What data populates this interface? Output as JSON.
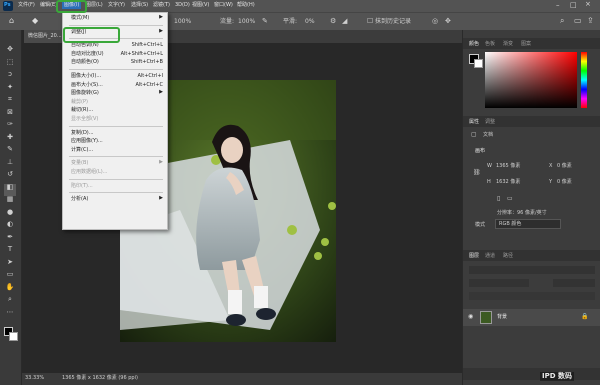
{
  "app": {
    "logo": "Ps"
  },
  "menubar": {
    "items": [
      "文件(F)",
      "编辑(E)",
      "图像(I)",
      "图层(L)",
      "文字(Y)",
      "选择(S)",
      "滤镜(T)",
      "3D(D)",
      "视图(V)",
      "窗口(W)",
      "帮助(H)"
    ],
    "active_index": 2
  },
  "options_bar": {
    "zoom_a": "100%",
    "opacity_label": "流量:",
    "zoom_b": "100%",
    "smooth_label": "平滑:",
    "zoom_c": "0%",
    "history_label": "抹到历史记录"
  },
  "document": {
    "tab_title": "微信图片_20..."
  },
  "image_menu": {
    "items": [
      {
        "label": "模式(M)",
        "submenu": true
      },
      {
        "sep": true
      },
      {
        "label": "调整(J)",
        "submenu": true
      },
      {
        "sep": true
      },
      {
        "label": "自动色调(N)",
        "shortcut": "Shift+Ctrl+L"
      },
      {
        "label": "自动对比度(U)",
        "shortcut": "Alt+Shift+Ctrl+L"
      },
      {
        "label": "自动颜色(O)",
        "shortcut": "Shift+Ctrl+B"
      },
      {
        "sep": true
      },
      {
        "label": "图像大小(I)...",
        "shortcut": "Alt+Ctrl+I"
      },
      {
        "label": "画布大小(S)...",
        "shortcut": "Alt+Ctrl+C"
      },
      {
        "label": "图像旋转(G)",
        "submenu": true
      },
      {
        "label": "裁剪(P)",
        "disabled": true
      },
      {
        "label": "裁切(R)..."
      },
      {
        "label": "显示全部(V)",
        "disabled": true
      },
      {
        "sep": true
      },
      {
        "label": "复制(D)..."
      },
      {
        "label": "应用图像(Y)..."
      },
      {
        "label": "计算(C)..."
      },
      {
        "sep": true
      },
      {
        "label": "变量(B)",
        "submenu": true,
        "disabled": true
      },
      {
        "label": "应用数据组(L)...",
        "disabled": true
      },
      {
        "sep": true
      },
      {
        "label": "陷印(T)...",
        "disabled": true
      },
      {
        "sep": true
      },
      {
        "label": "分析(A)",
        "submenu": true
      }
    ]
  },
  "status_bar": {
    "zoom": "33.33%",
    "doc_info": "1365 像素 x 1632 像素 (96 ppi)"
  },
  "panels": {
    "color_tabs": [
      "颜色",
      "色板",
      "渐变",
      "图案"
    ],
    "props_tabs": [
      "属性",
      "调整"
    ],
    "props_doc_label": "文档",
    "canvas_section": "画布",
    "w_label": "W",
    "w_value": "1365 像素",
    "h_label": "H",
    "h_value": "1632 像素",
    "x_label": "X",
    "x_value": "0 像素",
    "y_label": "Y",
    "y_value": "0 像素",
    "resolution": "分辨率：96 像素/英寸",
    "mode_label": "模式",
    "mode_value": "RGB 颜色",
    "layers_tabs": [
      "图层",
      "通道",
      "路径"
    ],
    "layer_name": "背景"
  },
  "watermark": "IPD 数码"
}
